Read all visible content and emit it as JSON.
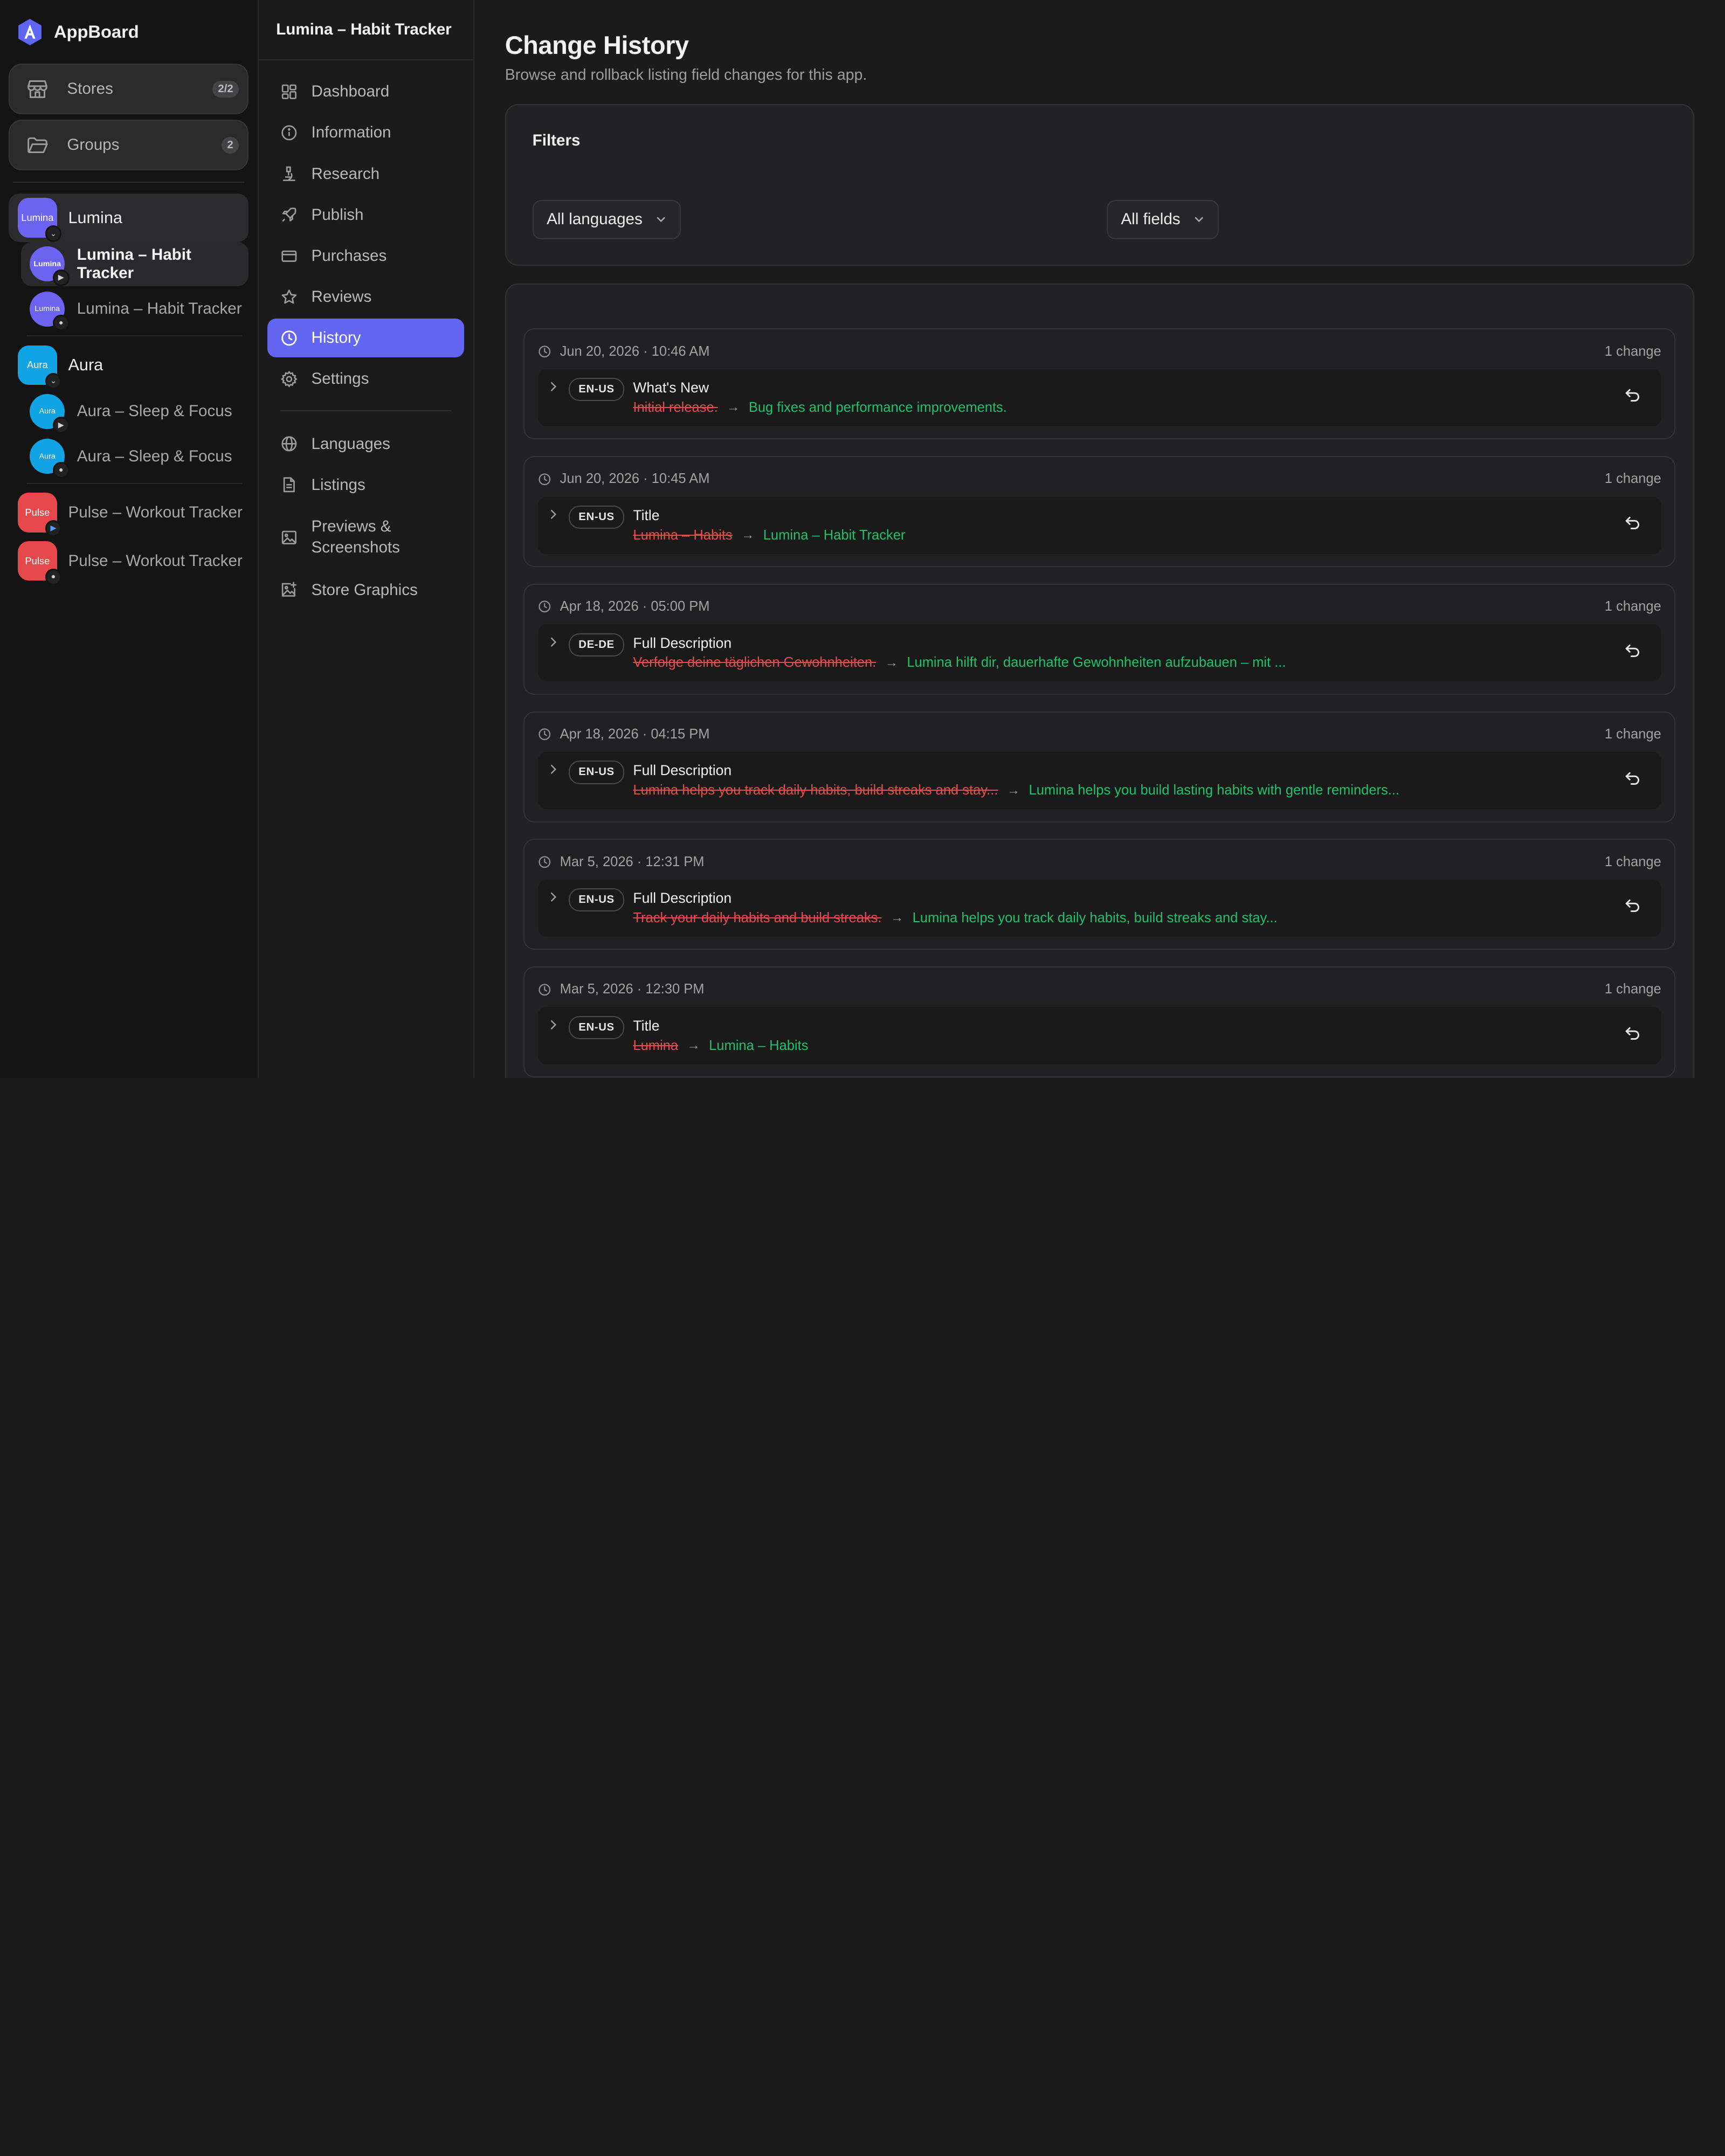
{
  "brand": {
    "name": "AppBoard",
    "logo_icon": "appboard-logo-icon"
  },
  "sidebar": {
    "stores": {
      "label": "Stores",
      "badge": "2/2",
      "icon": "store-icon"
    },
    "groups": {
      "label": "Groups",
      "badge": "2",
      "icon": "folder-icon"
    },
    "lumina": {
      "label": "Lumina",
      "thumb": "Lumina",
      "apps": [
        {
          "label": "Lumina – Habit Tracker",
          "thumb": "Lumina",
          "platform": "google-play-icon"
        },
        {
          "label": "Lumina – Habit Tracker",
          "thumb": "Lumina",
          "platform": "apple-icon"
        }
      ]
    },
    "aura": {
      "label": "Aura",
      "thumb": "Aura",
      "apps": [
        {
          "label": "Aura – Sleep & Focus",
          "thumb": "Aura",
          "platform": "google-play-icon"
        },
        {
          "label": "Aura – Sleep & Focus",
          "thumb": "Aura",
          "platform": "apple-icon"
        }
      ]
    },
    "pulse": [
      {
        "label": "Pulse – Workout Tracker",
        "thumb": "Pulse",
        "platform": "google-play-icon"
      },
      {
        "label": "Pulse – Workout Tracker",
        "thumb": "Pulse",
        "platform": "apple-icon"
      }
    ]
  },
  "subnav": {
    "title": "Lumina – Habit Tracker",
    "items": [
      {
        "label": "Dashboard",
        "icon": "dashboard-icon"
      },
      {
        "label": "Information",
        "icon": "info-icon"
      },
      {
        "label": "Research",
        "icon": "microscope-icon"
      },
      {
        "label": "Publish",
        "icon": "rocket-icon"
      },
      {
        "label": "Purchases",
        "icon": "credit-card-icon"
      },
      {
        "label": "Reviews",
        "icon": "star-icon"
      },
      {
        "label": "History",
        "icon": "clock-icon",
        "active": true
      },
      {
        "label": "Settings",
        "icon": "gear-icon"
      }
    ],
    "items2": [
      {
        "label": "Languages",
        "icon": "globe-icon"
      },
      {
        "label": "Listings",
        "icon": "document-icon"
      },
      {
        "label": "Previews & Screenshots",
        "icon": "image-icon"
      },
      {
        "label": "Store Graphics",
        "icon": "image-plus-icon"
      }
    ]
  },
  "main": {
    "title": "Change History",
    "subtitle": "Browse and rollback listing field changes for this app.",
    "filters": {
      "title": "Filters",
      "language_select": "All languages",
      "field_select": "All fields"
    },
    "entries": [
      {
        "date": "Jun 20, 2026 · 10:46 AM",
        "count": "1 change",
        "lang": "EN-US",
        "field": "What's New",
        "old": "Initial release.",
        "new": "Bug fixes and performance improvements."
      },
      {
        "date": "Jun 20, 2026 · 10:45 AM",
        "count": "1 change",
        "lang": "EN-US",
        "field": "Title",
        "old": "Lumina – Habits",
        "new": "Lumina – Habit Tracker"
      },
      {
        "date": "Apr 18, 2026 · 05:00 PM",
        "count": "1 change",
        "lang": "DE-DE",
        "field": "Full Description",
        "old": "Verfolge deine täglichen Gewohnheiten.",
        "new": "Lumina hilft dir, dauerhafte Gewohnheiten aufzubauen – mit ..."
      },
      {
        "date": "Apr 18, 2026 · 04:15 PM",
        "count": "1 change",
        "lang": "EN-US",
        "field": "Full Description",
        "old": "Lumina helps you track daily habits, build streaks and stay...",
        "new": "Lumina helps you build lasting habits with gentle reminders..."
      },
      {
        "date": "Mar 5, 2026 · 12:31 PM",
        "count": "1 change",
        "lang": "EN-US",
        "field": "Full Description",
        "old": "Track your daily habits and build streaks.",
        "new": "Lumina helps you track daily habits, build streaks and stay..."
      },
      {
        "date": "Mar 5, 2026 · 12:30 PM",
        "count": "1 change",
        "lang": "EN-US",
        "field": "Title",
        "old": "Lumina",
        "new": "Lumina – Habits"
      }
    ]
  },
  "colors": {
    "accent": "#6366f1",
    "removed": "#e54d4d",
    "added": "#20c16b",
    "lumina": "#6c63f0",
    "aura": "#10a4e4",
    "pulse": "#e6484c"
  }
}
